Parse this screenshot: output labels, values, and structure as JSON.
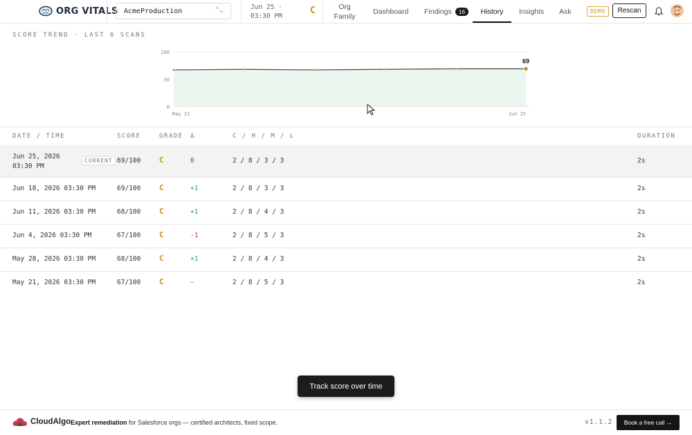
{
  "app": {
    "name": "ORG VITALS"
  },
  "header": {
    "org_selector": "AcmeProduction",
    "scan_date": "Jun 25 · 03:30 PM",
    "grade": "C",
    "nav": {
      "family": "Org Family",
      "dashboard": "Dashboard",
      "findings": "Findings",
      "findings_count": "16",
      "history": "History",
      "insights": "Insights",
      "ask": "Ask"
    },
    "demo_badge": "DEMO",
    "rescan_label": "Rescan"
  },
  "chart_section": {
    "title": "SCORE TREND · LAST 6 SCANS"
  },
  "chart_data": {
    "type": "area",
    "x": [
      "May 21",
      "May 28",
      "Jun 4",
      "Jun 11",
      "Jun 18",
      "Jun 25"
    ],
    "series": [
      {
        "values": [
          67,
          68,
          67,
          68,
          69,
          69
        ]
      }
    ],
    "ylim": [
      0,
      100
    ],
    "yticks": [
      "100",
      "50",
      "0"
    ],
    "xtick_labels": [
      "May 21",
      "Jun 25"
    ],
    "last_value_label": "69",
    "line_color": "#444444",
    "point_color": "#c4911a",
    "fill_color": "#eaf6ee",
    "grid": true
  },
  "table": {
    "headers": {
      "date": "DATE / TIME",
      "score": "SCORE",
      "grade": "GRADE",
      "delta": "Δ",
      "counts": "C / H / M / L",
      "duration": "DURATION"
    },
    "current_tag": "CURRENT",
    "rows": [
      {
        "date": "Jun 25, 2026",
        "time": "03:30 PM",
        "score": "69/100",
        "grade": "C",
        "delta": "0",
        "counts": "2 / 8 / 3 / 3",
        "duration": "2s"
      },
      {
        "date": "Jun 18, 2026 03:30 PM",
        "score": "69/100",
        "grade": "C",
        "delta": "+1",
        "counts": "2 / 8 / 3 / 3",
        "duration": "2s"
      },
      {
        "date": "Jun 11, 2026 03:30 PM",
        "score": "68/100",
        "grade": "C",
        "delta": "+1",
        "counts": "2 / 8 / 4 / 3",
        "duration": "2s"
      },
      {
        "date": "Jun 4, 2026 03:30 PM",
        "score": "67/100",
        "grade": "C",
        "delta": "-1",
        "counts": "2 / 8 / 5 / 3",
        "duration": "2s"
      },
      {
        "date": "May 28, 2026 03:30 PM",
        "score": "68/100",
        "grade": "C",
        "delta": "+1",
        "counts": "2 / 8 / 4 / 3",
        "duration": "2s"
      },
      {
        "date": "May 21, 2026 03:30 PM",
        "score": "67/100",
        "grade": "C",
        "delta": "—",
        "counts": "2 / 8 / 5 / 3",
        "duration": "2s"
      }
    ]
  },
  "tooltip": {
    "text": "Track score over time"
  },
  "footer": {
    "brand": "CloudAlgo",
    "promo_bold": "Expert remediation",
    "promo_rest": " for Salesforce orgs — certified architects, fixed scope.",
    "version": "v1.1.2",
    "cta": "Book a free call →"
  },
  "colors": {
    "accent_grade": "#c4911a",
    "positive": "#3a9a55",
    "negative": "#c0392b"
  }
}
